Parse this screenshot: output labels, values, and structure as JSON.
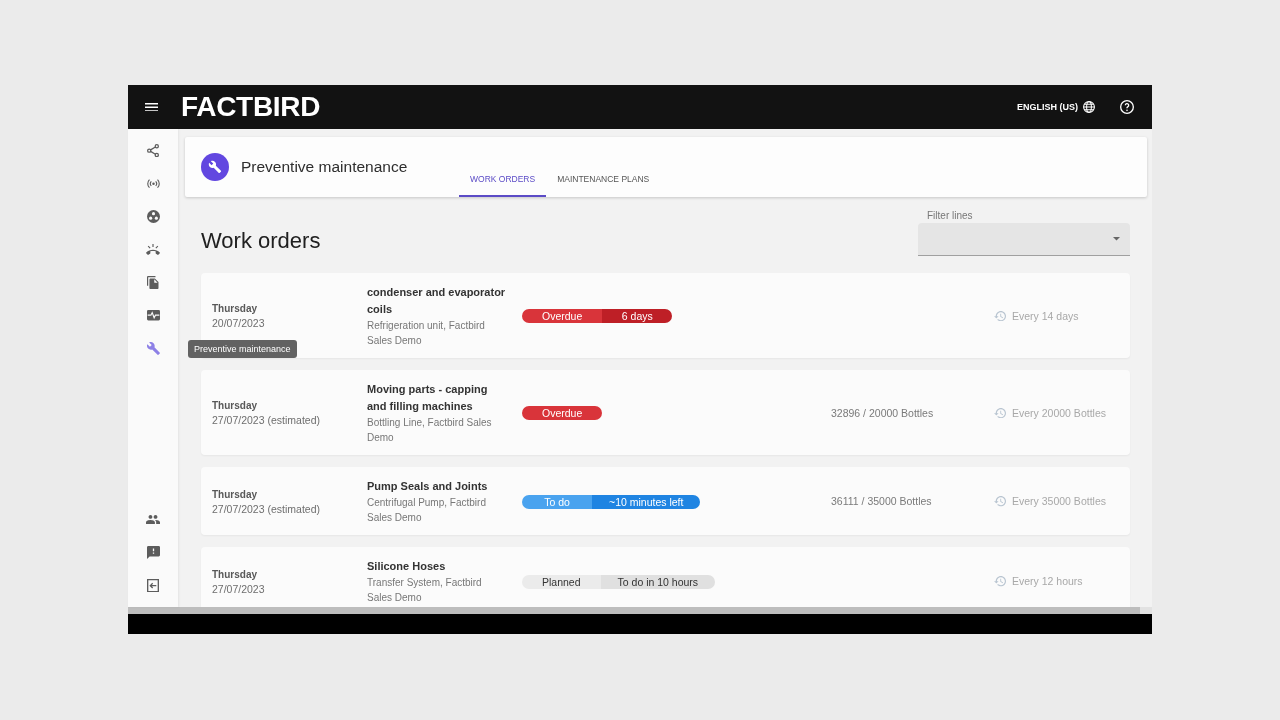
{
  "top_bar": {
    "logo": "FACTBIRD",
    "language": "ENGLISH (US)"
  },
  "sidebar": {
    "top_items": [
      {
        "selected": false
      },
      {
        "selected": false
      },
      {
        "selected": false
      },
      {
        "selected": false
      },
      {
        "selected": false
      },
      {
        "selected": false
      },
      {
        "selected": true,
        "tooltip": "Preventive maintenance"
      }
    ],
    "bottom_items": [
      {
        "selected": false
      },
      {
        "selected": false
      },
      {
        "selected": false
      }
    ]
  },
  "page_header": {
    "title": "Preventive maintenance",
    "tabs": [
      {
        "label": "WORK ORDERS",
        "selected": true
      },
      {
        "label": "MAINTENANCE PLANS",
        "selected": false
      }
    ]
  },
  "work_orders": {
    "heading": "Work orders",
    "filter": {
      "label": "Filter lines"
    },
    "rows": [
      {
        "day": "Thursday",
        "date": "20/07/2023",
        "title": "condenser and evaporator coils",
        "location": "Refrigeration unit, Factbird Sales Demo",
        "status": {
          "kind": "overdue",
          "label": "Overdue",
          "detail": "6 days"
        },
        "interval": "Every 14 days"
      },
      {
        "day": "Thursday",
        "date": "27/07/2023 (estimated)",
        "title": "Moving parts - capping and filling machines",
        "location": "Bottling Line, Factbird Sales Demo",
        "status": {
          "kind": "overdue",
          "label": "Overdue"
        },
        "counter": "32896 / 20000 Bottles",
        "interval": "Every 20000 Bottles"
      },
      {
        "day": "Thursday",
        "date": "27/07/2023 (estimated)",
        "title": "Pump Seals and Joints",
        "location": "Centrifugal Pump, Factbird Sales Demo",
        "status": {
          "kind": "todo",
          "label": "To do",
          "detail": "~10 minutes left"
        },
        "counter": "36111 / 35000 Bottles",
        "interval": "Every 35000 Bottles"
      },
      {
        "day": "Thursday",
        "date": "27/07/2023",
        "title": "Silicone Hoses",
        "location": "Transfer System, Factbird Sales Demo",
        "status": {
          "kind": "planned",
          "label": "Planned",
          "detail": "To do in 10 hours"
        },
        "interval": "Every 12 hours"
      }
    ]
  }
}
